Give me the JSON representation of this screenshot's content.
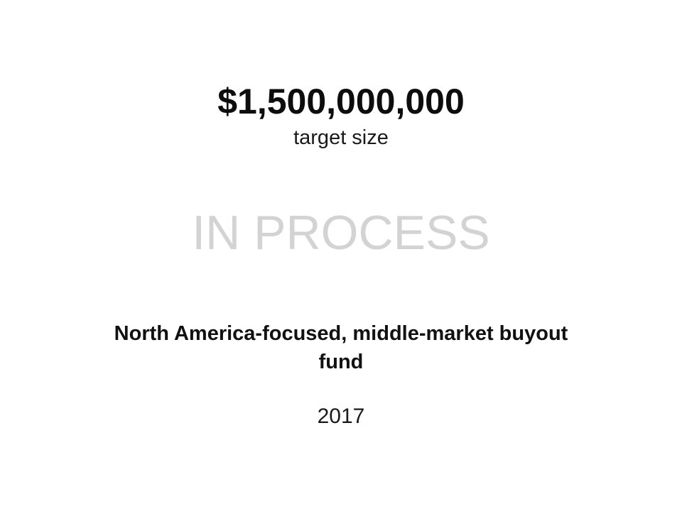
{
  "fund": {
    "target_amount": "$1,500,000,000",
    "target_label": "target size",
    "status": "IN PROCESS",
    "description": "North America-focused, middle-market buyout fund",
    "year": "2017"
  }
}
